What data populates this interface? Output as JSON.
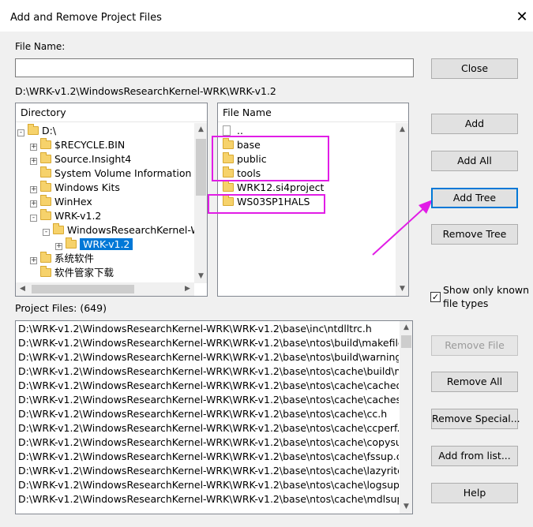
{
  "dialog": {
    "title": "Add and Remove Project Files",
    "close_glyph": "✕"
  },
  "file_name": {
    "label": "File Name:",
    "value": ""
  },
  "current_path": "D:\\WRK-v1.2\\WindowsResearchKernel-WRK\\WRK-v1.2",
  "directory": {
    "header": "Directory",
    "items": [
      {
        "label": "D:\\",
        "expander": "-"
      },
      {
        "label": "$RECYCLE.BIN",
        "expander": "+"
      },
      {
        "label": "Source.Insight4",
        "expander": "+"
      },
      {
        "label": "System Volume Information",
        "expander": ""
      },
      {
        "label": "Windows Kits",
        "expander": "+"
      },
      {
        "label": "WinHex",
        "expander": "+"
      },
      {
        "label": "WRK-v1.2",
        "expander": "-"
      },
      {
        "label": "WindowsResearchKernel-W",
        "expander": "-"
      },
      {
        "label": "WRK-v1.2",
        "expander": "+"
      },
      {
        "label": "系统软件",
        "expander": "+"
      },
      {
        "label": "软件管家下载",
        "expander": ""
      }
    ]
  },
  "file_list": {
    "header": "File Name",
    "items": [
      {
        "label": "..",
        "icon": "file-icon"
      },
      {
        "label": "base",
        "icon": "folder-icon"
      },
      {
        "label": "public",
        "icon": "folder-icon"
      },
      {
        "label": "tools",
        "icon": "folder-icon"
      },
      {
        "label": "WRK12.si4project",
        "icon": "folder-icon"
      },
      {
        "label": "WS03SP1HALS",
        "icon": "folder-icon"
      }
    ]
  },
  "buttons": {
    "close": "Close",
    "add": "Add",
    "add_all": "Add All",
    "add_tree": "Add Tree",
    "remove_tree": "Remove Tree",
    "remove_file": "Remove File",
    "remove_all": "Remove All",
    "remove_special": "Remove Special...",
    "add_from_list": "Add from list...",
    "help": "Help"
  },
  "show_known": {
    "label_line1": "Show only known",
    "label_line2": "file types",
    "checked": true,
    "check_glyph": "✓"
  },
  "project_files": {
    "label": "Project Files: (649)",
    "items": [
      "D:\\WRK-v1.2\\WindowsResearchKernel-WRK\\WRK-v1.2\\base\\inc\\ntdlltrc.h",
      "D:\\WRK-v1.2\\WindowsResearchKernel-WRK\\WRK-v1.2\\base\\ntos\\build\\makefile",
      "D:\\WRK-v1.2\\WindowsResearchKernel-WRK\\WRK-v1.2\\base\\ntos\\build\\warning.h",
      "D:\\WRK-v1.2\\WindowsResearchKernel-WRK\\WRK-v1.2\\base\\ntos\\cache\\build\\make",
      "D:\\WRK-v1.2\\WindowsResearchKernel-WRK\\WRK-v1.2\\base\\ntos\\cache\\cachedat.c",
      "D:\\WRK-v1.2\\WindowsResearchKernel-WRK\\WRK-v1.2\\base\\ntos\\cache\\cachesub.c",
      "D:\\WRK-v1.2\\WindowsResearchKernel-WRK\\WRK-v1.2\\base\\ntos\\cache\\cc.h",
      "D:\\WRK-v1.2\\WindowsResearchKernel-WRK\\WRK-v1.2\\base\\ntos\\cache\\ccperf.c",
      "D:\\WRK-v1.2\\WindowsResearchKernel-WRK\\WRK-v1.2\\base\\ntos\\cache\\copysup.c",
      "D:\\WRK-v1.2\\WindowsResearchKernel-WRK\\WRK-v1.2\\base\\ntos\\cache\\fssup.c",
      "D:\\WRK-v1.2\\WindowsResearchKernel-WRK\\WRK-v1.2\\base\\ntos\\cache\\lazyrite.c",
      "D:\\WRK-v1.2\\WindowsResearchKernel-WRK\\WRK-v1.2\\base\\ntos\\cache\\logsup.c",
      "D:\\WRK-v1.2\\WindowsResearchKernel-WRK\\WRK-v1.2\\base\\ntos\\cache\\mdlsup.c"
    ]
  },
  "colors": {
    "highlight_box": "#e11de6",
    "selection": "#0078d7",
    "arrow": "#e11de6"
  }
}
